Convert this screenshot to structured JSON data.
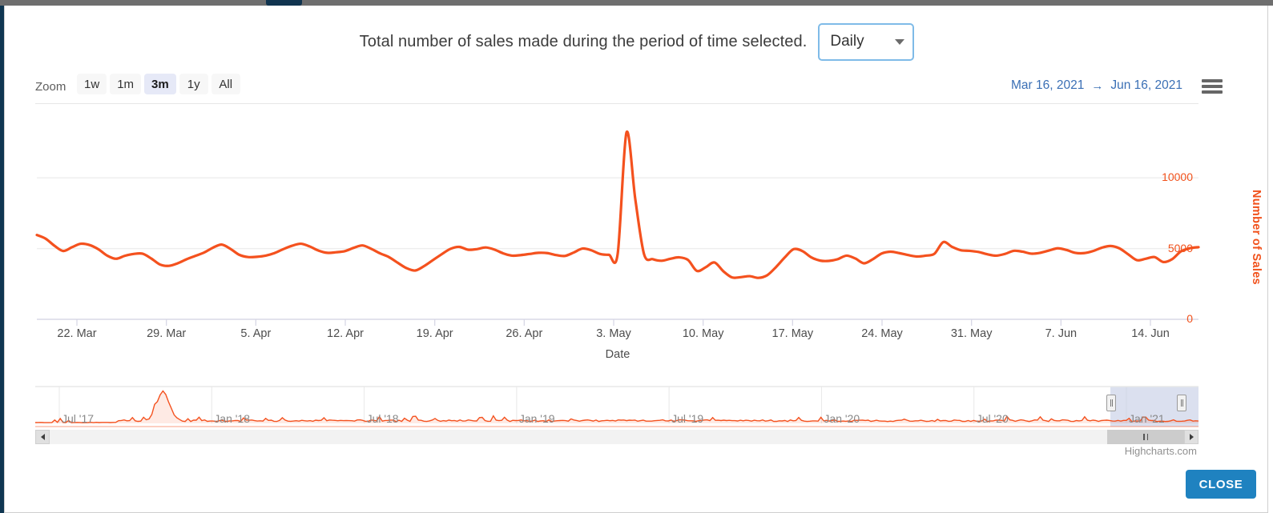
{
  "header": {
    "caption": "Total number of sales made during the period of time selected.",
    "granularity_value": "Daily",
    "granularity_options": [
      "Daily"
    ]
  },
  "range_selector": {
    "zoom_label": "Zoom",
    "buttons": [
      {
        "label": "1w",
        "selected": false
      },
      {
        "label": "1m",
        "selected": false
      },
      {
        "label": "3m",
        "selected": true
      },
      {
        "label": "1y",
        "selected": false
      },
      {
        "label": "All",
        "selected": false
      }
    ],
    "date_from": "Mar 16, 2021",
    "date_arrow": "→",
    "date_to": "Jun 16, 2021",
    "menu_icon": "hamburger-menu-icon"
  },
  "footer": {
    "close_label": "CLOSE",
    "credits": "Highcharts.com"
  },
  "navigator": {
    "labels": [
      "Jul '17",
      "Jan '18",
      "Jul '18",
      "Jan '19",
      "Jul '19",
      "Jan '20",
      "Jul '20",
      "Jan '21"
    ],
    "selected_from": "Mar 16, 2021",
    "selected_to": "Jun 16, 2021",
    "scroll_left_icon": "triangle-left-icon",
    "scroll_right_icon": "triangle-right-icon"
  },
  "chart_data": {
    "type": "line",
    "title": "",
    "xlabel": "Date",
    "ylabel": "Number of Sales",
    "ylim": [
      0,
      13800
    ],
    "yticks": [
      0,
      5000,
      10000
    ],
    "ytick_labels": [
      "0",
      "5000",
      "10000"
    ],
    "grid": true,
    "legend": "none",
    "line_color": "#f4511e",
    "axis_label_color": "#f1511b",
    "xtick_labels": [
      "22. Mar",
      "29. Mar",
      "5. Apr",
      "12. Apr",
      "19. Apr",
      "26. Apr",
      "3. May",
      "10. May",
      "17. May",
      "24. May",
      "31. May",
      "7. Jun",
      "14. Jun"
    ],
    "x_start": "2021-03-16",
    "x_end": "2021-06-16",
    "values": [
      5960,
      5700,
      5200,
      4830,
      5100,
      5340,
      5250,
      4950,
      4500,
      4280,
      4490,
      4620,
      4640,
      4300,
      3870,
      3780,
      3960,
      4240,
      4480,
      4720,
      5060,
      5280,
      4980,
      4560,
      4400,
      4420,
      4500,
      4680,
      4960,
      5200,
      5340,
      5150,
      4860,
      4700,
      4740,
      4820,
      5050,
      5220,
      4980,
      4660,
      4400,
      4000,
      3620,
      3450,
      3760,
      4180,
      4600,
      4980,
      5120,
      4920,
      4960,
      5080,
      4930,
      4660,
      4500,
      4540,
      4620,
      4700,
      4680,
      4540,
      4480,
      4720,
      5000,
      4880,
      4620,
      4560,
      4620,
      13200,
      8500,
      4600,
      4250,
      4140,
      4280,
      4380,
      4190,
      3420,
      3680,
      4020,
      3400,
      2960,
      2980,
      3050,
      2930,
      3120,
      3700,
      4380,
      4960,
      4820,
      4380,
      4150,
      4130,
      4250,
      4500,
      4300,
      3960,
      4250,
      4650,
      4780,
      4680,
      4540,
      4440,
      4500,
      4640,
      5460,
      5120,
      4880,
      4840,
      4760,
      4600,
      4500,
      4620,
      4840,
      4780,
      4640,
      4700,
      4860,
      5020,
      4900,
      4700,
      4680,
      4820,
      5060,
      5180,
      5020,
      4600,
      4180,
      4280,
      4400,
      4050,
      4250,
      4800,
      5020,
      5100
    ],
    "navigator_series": {
      "x_start": "2017-05-01",
      "x_end": "2021-06-16",
      "peak_note": "large spike near Nov '17"
    }
  }
}
